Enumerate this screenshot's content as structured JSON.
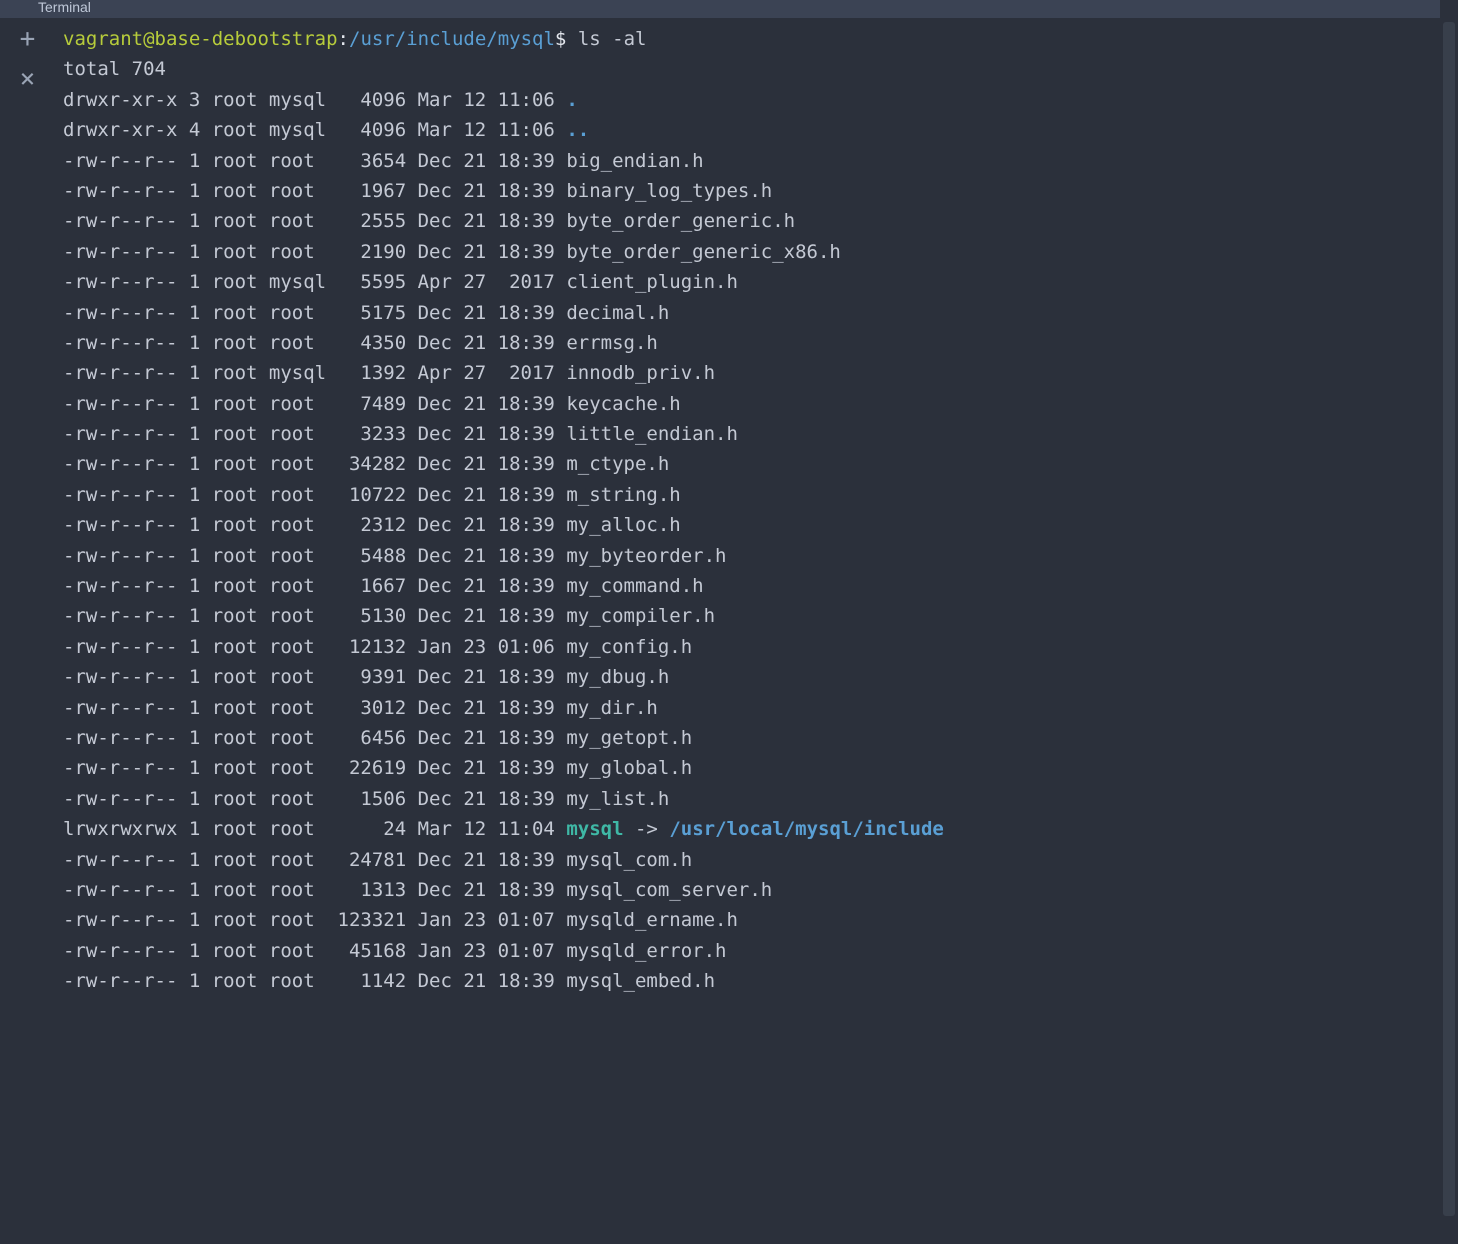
{
  "title": "Terminal",
  "prompt": {
    "user": "vagrant@base-debootstrap",
    "sep": ":",
    "path": "/usr/include/mysql",
    "sigil": "$",
    "command": "ls -al"
  },
  "total_line": "total 704",
  "entries": [
    {
      "perm": "drwxr-xr-x",
      "n": "3",
      "u": "root",
      "g": "mysql",
      "size": "4096",
      "date": "Mar 12 11:06",
      "name": ".",
      "type": "dir"
    },
    {
      "perm": "drwxr-xr-x",
      "n": "4",
      "u": "root",
      "g": "mysql",
      "size": "4096",
      "date": "Mar 12 11:06",
      "name": "..",
      "type": "dir"
    },
    {
      "perm": "-rw-r--r--",
      "n": "1",
      "u": "root",
      "g": "root",
      "size": "3654",
      "date": "Dec 21 18:39",
      "name": "big_endian.h",
      "type": "file"
    },
    {
      "perm": "-rw-r--r--",
      "n": "1",
      "u": "root",
      "g": "root",
      "size": "1967",
      "date": "Dec 21 18:39",
      "name": "binary_log_types.h",
      "type": "file"
    },
    {
      "perm": "-rw-r--r--",
      "n": "1",
      "u": "root",
      "g": "root",
      "size": "2555",
      "date": "Dec 21 18:39",
      "name": "byte_order_generic.h",
      "type": "file"
    },
    {
      "perm": "-rw-r--r--",
      "n": "1",
      "u": "root",
      "g": "root",
      "size": "2190",
      "date": "Dec 21 18:39",
      "name": "byte_order_generic_x86.h",
      "type": "file"
    },
    {
      "perm": "-rw-r--r--",
      "n": "1",
      "u": "root",
      "g": "mysql",
      "size": "5595",
      "date": "Apr 27  2017",
      "name": "client_plugin.h",
      "type": "file"
    },
    {
      "perm": "-rw-r--r--",
      "n": "1",
      "u": "root",
      "g": "root",
      "size": "5175",
      "date": "Dec 21 18:39",
      "name": "decimal.h",
      "type": "file"
    },
    {
      "perm": "-rw-r--r--",
      "n": "1",
      "u": "root",
      "g": "root",
      "size": "4350",
      "date": "Dec 21 18:39",
      "name": "errmsg.h",
      "type": "file"
    },
    {
      "perm": "-rw-r--r--",
      "n": "1",
      "u": "root",
      "g": "mysql",
      "size": "1392",
      "date": "Apr 27  2017",
      "name": "innodb_priv.h",
      "type": "file"
    },
    {
      "perm": "-rw-r--r--",
      "n": "1",
      "u": "root",
      "g": "root",
      "size": "7489",
      "date": "Dec 21 18:39",
      "name": "keycache.h",
      "type": "file"
    },
    {
      "perm": "-rw-r--r--",
      "n": "1",
      "u": "root",
      "g": "root",
      "size": "3233",
      "date": "Dec 21 18:39",
      "name": "little_endian.h",
      "type": "file"
    },
    {
      "perm": "-rw-r--r--",
      "n": "1",
      "u": "root",
      "g": "root",
      "size": "34282",
      "date": "Dec 21 18:39",
      "name": "m_ctype.h",
      "type": "file"
    },
    {
      "perm": "-rw-r--r--",
      "n": "1",
      "u": "root",
      "g": "root",
      "size": "10722",
      "date": "Dec 21 18:39",
      "name": "m_string.h",
      "type": "file"
    },
    {
      "perm": "-rw-r--r--",
      "n": "1",
      "u": "root",
      "g": "root",
      "size": "2312",
      "date": "Dec 21 18:39",
      "name": "my_alloc.h",
      "type": "file"
    },
    {
      "perm": "-rw-r--r--",
      "n": "1",
      "u": "root",
      "g": "root",
      "size": "5488",
      "date": "Dec 21 18:39",
      "name": "my_byteorder.h",
      "type": "file"
    },
    {
      "perm": "-rw-r--r--",
      "n": "1",
      "u": "root",
      "g": "root",
      "size": "1667",
      "date": "Dec 21 18:39",
      "name": "my_command.h",
      "type": "file"
    },
    {
      "perm": "-rw-r--r--",
      "n": "1",
      "u": "root",
      "g": "root",
      "size": "5130",
      "date": "Dec 21 18:39",
      "name": "my_compiler.h",
      "type": "file"
    },
    {
      "perm": "-rw-r--r--",
      "n": "1",
      "u": "root",
      "g": "root",
      "size": "12132",
      "date": "Jan 23 01:06",
      "name": "my_config.h",
      "type": "file"
    },
    {
      "perm": "-rw-r--r--",
      "n": "1",
      "u": "root",
      "g": "root",
      "size": "9391",
      "date": "Dec 21 18:39",
      "name": "my_dbug.h",
      "type": "file"
    },
    {
      "perm": "-rw-r--r--",
      "n": "1",
      "u": "root",
      "g": "root",
      "size": "3012",
      "date": "Dec 21 18:39",
      "name": "my_dir.h",
      "type": "file"
    },
    {
      "perm": "-rw-r--r--",
      "n": "1",
      "u": "root",
      "g": "root",
      "size": "6456",
      "date": "Dec 21 18:39",
      "name": "my_getopt.h",
      "type": "file"
    },
    {
      "perm": "-rw-r--r--",
      "n": "1",
      "u": "root",
      "g": "root",
      "size": "22619",
      "date": "Dec 21 18:39",
      "name": "my_global.h",
      "type": "file"
    },
    {
      "perm": "-rw-r--r--",
      "n": "1",
      "u": "root",
      "g": "root",
      "size": "1506",
      "date": "Dec 21 18:39",
      "name": "my_list.h",
      "type": "file"
    },
    {
      "perm": "lrwxrwxrwx",
      "n": "1",
      "u": "root",
      "g": "root",
      "size": "24",
      "date": "Mar 12 11:04",
      "name": "mysql",
      "type": "symlink",
      "target": "/usr/local/mysql/include"
    },
    {
      "perm": "-rw-r--r--",
      "n": "1",
      "u": "root",
      "g": "root",
      "size": "24781",
      "date": "Dec 21 18:39",
      "name": "mysql_com.h",
      "type": "file"
    },
    {
      "perm": "-rw-r--r--",
      "n": "1",
      "u": "root",
      "g": "root",
      "size": "1313",
      "date": "Dec 21 18:39",
      "name": "mysql_com_server.h",
      "type": "file"
    },
    {
      "perm": "-rw-r--r--",
      "n": "1",
      "u": "root",
      "g": "root",
      "size": "123321",
      "date": "Jan 23 01:07",
      "name": "mysqld_ername.h",
      "type": "file"
    },
    {
      "perm": "-rw-r--r--",
      "n": "1",
      "u": "root",
      "g": "root",
      "size": "45168",
      "date": "Jan 23 01:07",
      "name": "mysqld_error.h",
      "type": "file"
    },
    {
      "perm": "-rw-r--r--",
      "n": "1",
      "u": "root",
      "g": "root",
      "size": "1142",
      "date": "Dec 21 18:39",
      "name": "mysql_embed.h",
      "type": "file"
    }
  ],
  "layout": {
    "size_width": 6,
    "group_width": 5
  }
}
